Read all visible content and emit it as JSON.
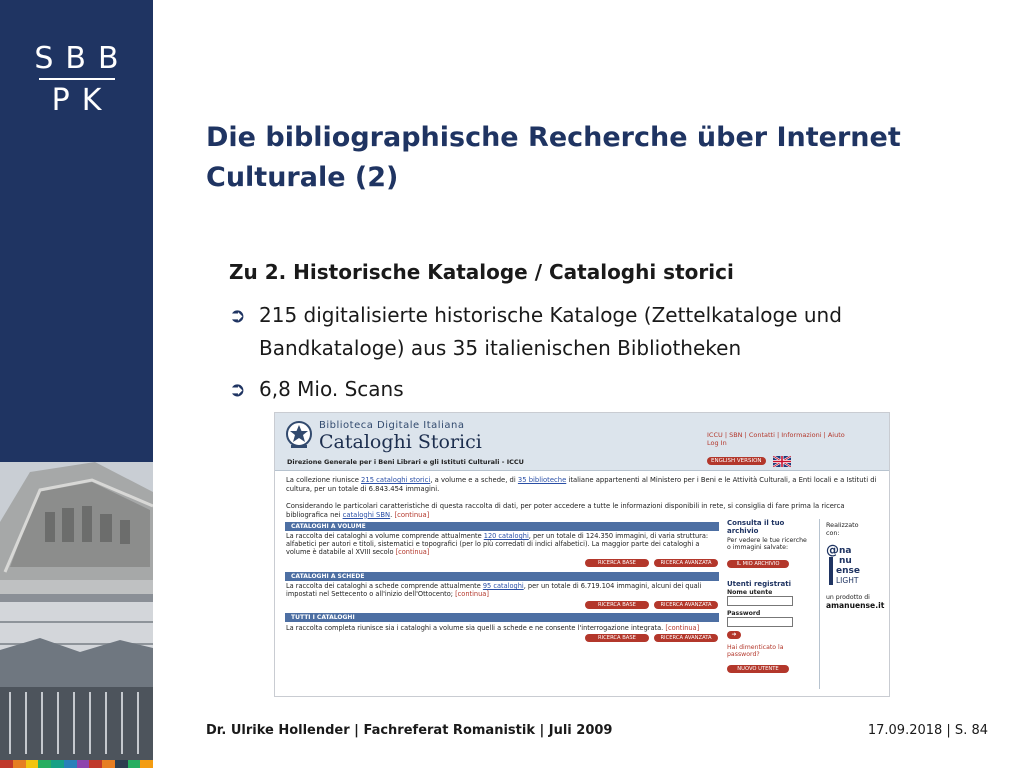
{
  "logo": {
    "line1": "SBB",
    "line2": "PK"
  },
  "title": "Die bibliographische Recherche über Internet Culturale (2)",
  "subheading": "Zu 2. Historische Kataloge / Cataloghi storici",
  "bullets": [
    "215 digitalisierte historische Kataloge (Zettelkataloge und Bandkataloge) aus 35 italienischen Bibliotheken",
    "6,8 Mio. Scans"
  ],
  "screenshot": {
    "brand": "Biblioteca Digitale Italiana",
    "name": "Cataloghi Storici",
    "dept": "Direzione Generale per i Beni Librari e gli Istituti Culturali - ICCU",
    "links": "ICCU | SBN | Contatti | Informazioni | Aiuto",
    "login": "Log In",
    "english": "ENGLISH VERSION",
    "intro_1a": "La collezione riunisce ",
    "intro_1_link1": "215 cataloghi storici",
    "intro_1b": ", a volume e a schede, di ",
    "intro_1_link2": "35 biblioteche",
    "intro_1c": " italiane appartenenti al Ministero per i Beni e le Attività Culturali, a Enti locali e a Istituti di cultura, per un totale di 6.843.454 immagini.",
    "intro_2a": "Considerando le particolari caratteristiche di questa raccolta di dati, per poter accedere a tutte le informazioni disponibili in rete, si consiglia di fare prima la ricerca bibliografica nei ",
    "intro_2_link": "cataloghi SBN",
    "intro_2b": ". ",
    "continua": "[continua]",
    "sections": [
      {
        "title": "CATALOGHI A VOLUME",
        "text_a": "La raccolta dei cataloghi a volume comprende attualmente ",
        "link": "120 cataloghi",
        "text_b": ", per un totale di 124.350 immagini, di varia struttura: alfabetici per autori e titoli, sistematici e topografici (per lo più corredati di indici alfabetici). La maggior parte dei cataloghi a volume è databile al XVIII secolo "
      },
      {
        "title": "CATALOGHI A SCHEDE",
        "text_a": "La raccolta dei cataloghi a schede comprende attualmente ",
        "link": "95 cataloghi",
        "text_b": ", per un totale di 6.719.104 immagini, alcuni dei quali impostati nel Settecento o all'inizio dell'Ottocento; "
      },
      {
        "title": "TUTTI I CATALOGHI",
        "text_a": "La raccolta completa riunisce sia i cataloghi a volume sia quelli a schede e ne consente l'interrogazione integrata. ",
        "link": "",
        "text_b": ""
      }
    ],
    "btn_base": "RICERCA BASE",
    "btn_adv": "RICERCA AVANZATA",
    "side": {
      "archive_h": "Consulta il tuo archivio",
      "archive_t": "Per vedere le tue ricerche o immagini salvate:",
      "archive_btn": "IL MIO ARCHIVIO",
      "users_h": "Utenti registrati",
      "user_lbl": "Nome utente",
      "pass_lbl": "Password",
      "forgot": "Hai dimenticato la password?",
      "new_user_btn": "NUOVO UTENTE"
    },
    "amanu": {
      "made": "Realizzato con:",
      "logo_text": "a nu ense LIGHT",
      "product": "un prodotto di",
      "site": "amanuense.it"
    }
  },
  "footer": {
    "left": "Dr. Ulrike Hollender | Fachreferat Romanistik | Juli 2009",
    "right": "17.09.2018 | S. 84"
  },
  "colors": {
    "sidebar": "#1f3462",
    "title": "#1f3462",
    "accent_red": "#b3372b"
  }
}
